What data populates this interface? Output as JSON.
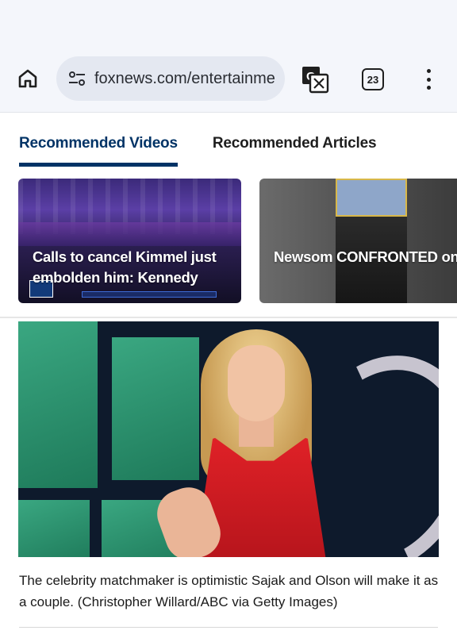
{
  "browser": {
    "url": "foxnews.com/entertainme",
    "tab_count": "23"
  },
  "recommended": {
    "tabs": [
      {
        "label": "Recommended Videos",
        "active": true
      },
      {
        "label": "Recommended Articles",
        "active": false
      }
    ],
    "videos": [
      {
        "title": "Calls to cancel Kimmel just embolden him: Kennedy"
      },
      {
        "title": "Newsom CONFRONTED on California's high costs"
      }
    ]
  },
  "article": {
    "photo_caption": "The celebrity matchmaker is optimistic Sajak and Olson will make it as a couple. (Christopher Willard/ABC via Getty Images)"
  },
  "colors": {
    "accent": "#003366",
    "toolbar_bg": "#f4f6fb",
    "omnibox_bg": "#e4e8f1",
    "dress_red": "#e02127"
  },
  "icons": [
    "home-icon",
    "site-settings-icon",
    "translate-icon",
    "tab-switcher-icon",
    "more-vert-icon"
  ]
}
